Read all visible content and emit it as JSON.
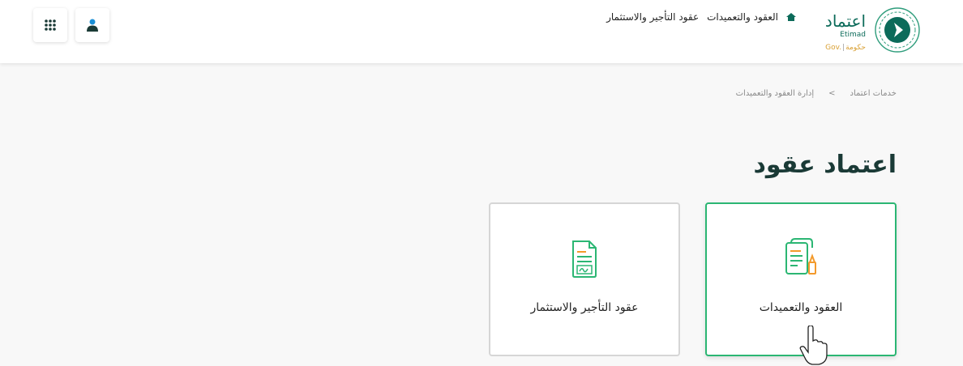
{
  "header": {
    "logo": {
      "arabic": "اعتماد",
      "english": "Etimad",
      "gov_en": "Gov.",
      "gov_ar": "حكومة"
    },
    "nav": [
      "العقود والتعميدات",
      "عقود التأجير والاستثمار"
    ]
  },
  "breadcrumb": [
    "خدمات اعتماد",
    ">",
    "إدارة العقود والتعميدات"
  ],
  "page": {
    "title": "اعتماد عقود"
  },
  "cards": [
    {
      "label": "العقود والتعميدات",
      "icon": "contract-pen-icon",
      "selected": true
    },
    {
      "label": "عقود التأجير والاستثمار",
      "icon": "document-signature-icon",
      "selected": false
    }
  ],
  "colors": {
    "brand": "#0c6b5a",
    "accent": "#2bb673",
    "gold": "#d9a033",
    "icon_orange": "#f39a2c",
    "apps_icon": "#1a3a36",
    "user_icon": "#1a8fd6"
  }
}
